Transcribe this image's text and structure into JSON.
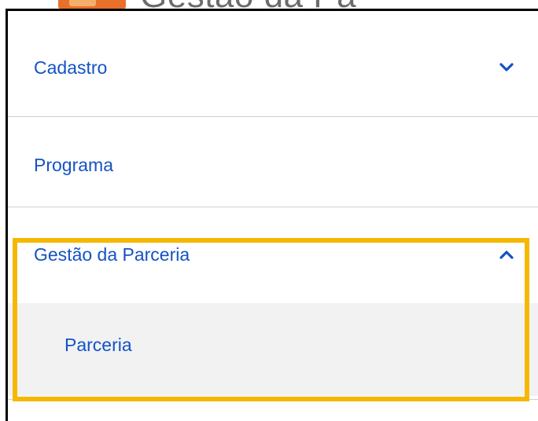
{
  "header": {
    "title": "Gestão da Pa"
  },
  "menu": {
    "items": [
      {
        "label": "Cadastro",
        "icon": "chevron-down-icon",
        "expanded": false
      },
      {
        "label": "Programa"
      },
      {
        "label": "Gestão da Parceria",
        "icon": "chevron-up-icon",
        "expanded": true,
        "children": [
          {
            "label": "Parceria"
          }
        ]
      }
    ]
  },
  "colors": {
    "link": "#1452c6",
    "highlight": "#f5b800",
    "submenu_bg": "#f2f2f2",
    "divider": "#cfcfcf",
    "logo": "#e8702a"
  }
}
